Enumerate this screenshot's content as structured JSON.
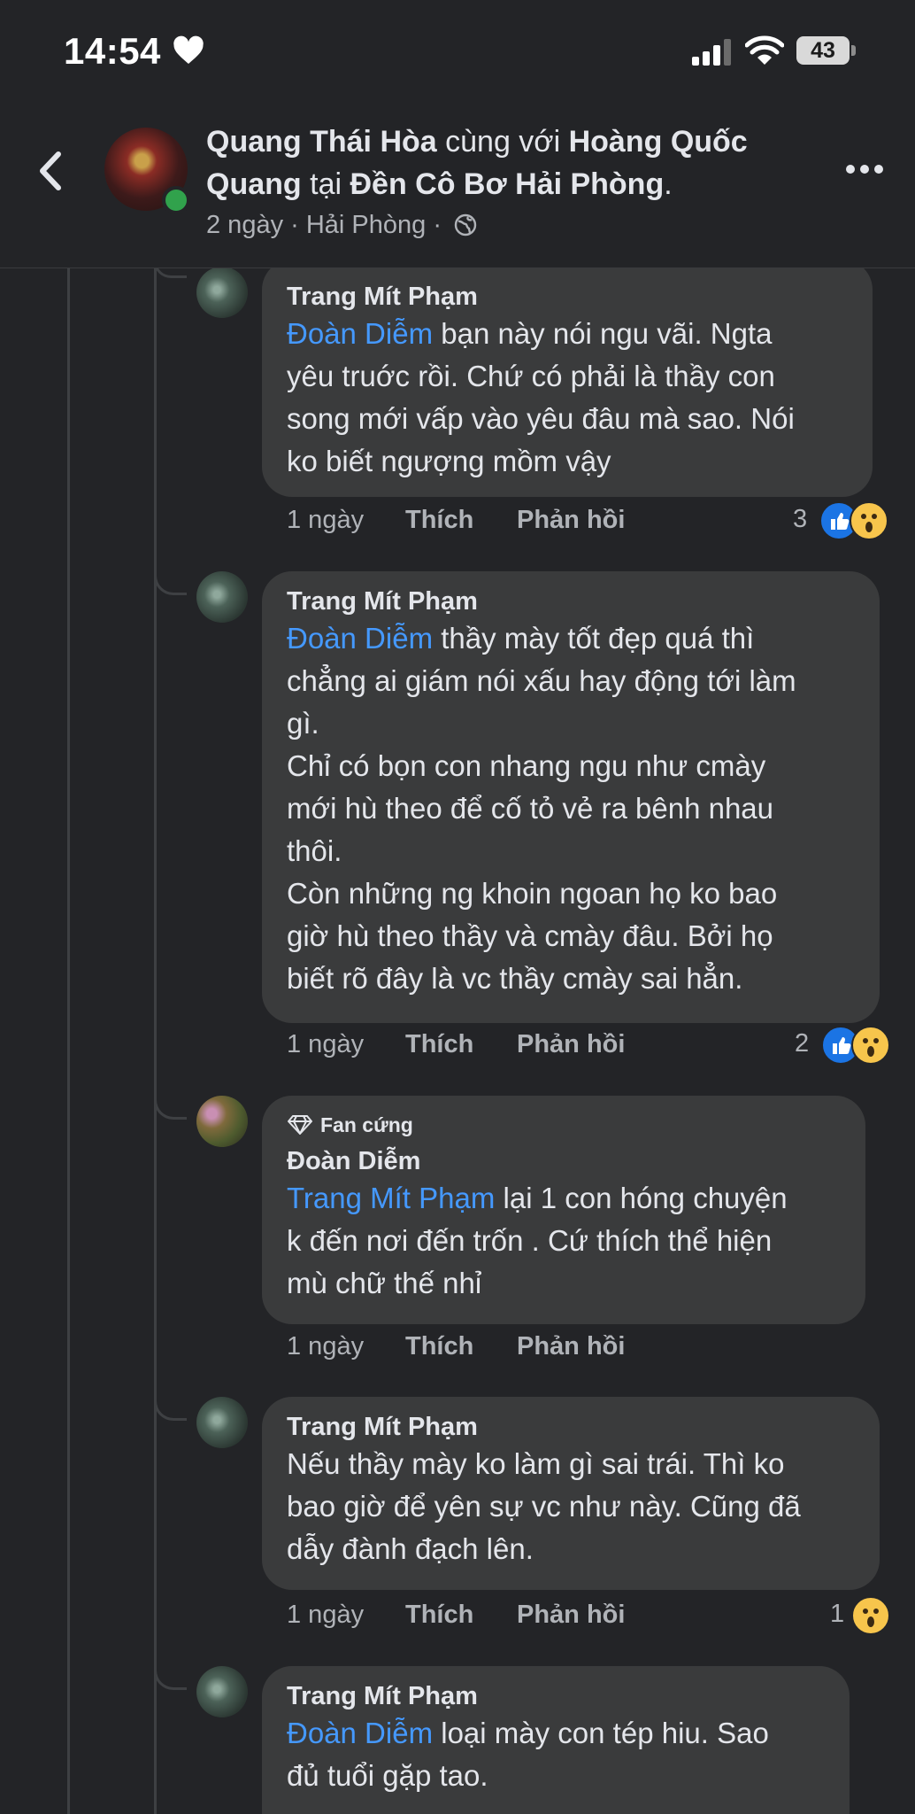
{
  "status_bar": {
    "time": "14:54",
    "battery": "43"
  },
  "header": {
    "author": "Quang Thái Hòa",
    "with_word": " cùng với ",
    "tagged": "Hoàng Quốc Quang",
    "at_word": " tại ",
    "place": "Đền Cô Bơ Hải Phòng",
    "end": ".",
    "meta": "2 ngày · Hải Phòng ·"
  },
  "labels": {
    "like": "Thích",
    "reply": "Phản hồi"
  },
  "comments": [
    {
      "author": "Trang Mít Phạm",
      "mention": "Đoàn Diễm",
      "lines": [
        " bạn này nói ngu vãi. Ngta",
        "yêu truớc rồi. Chứ có phải là thầy con",
        "song mới vấp vào yêu đâu mà sao. Nói",
        "ko biết ngượng mồm vậy"
      ],
      "time": "1 ngày",
      "reaction_count": "3",
      "reactions": [
        "like-icon",
        "wow-icon"
      ]
    },
    {
      "author": "Trang Mít Phạm",
      "mention": "Đoàn Diễm",
      "lines": [
        " thầy mày tốt đẹp quá thì",
        "chẳng ai giám nói xấu hay động tới làm",
        "gì.",
        "Chỉ có bọn con nhang ngu như cmày",
        "mới hù theo để cố tỏ vẻ ra bênh nhau",
        "thôi.",
        "Còn những ng khoin ngoan họ ko bao",
        "giờ hù theo thầy và cmày đâu. Bởi họ",
        "biết rõ đây là vc thầy cmày sai hẳn."
      ],
      "time": "1 ngày",
      "reaction_count": "2",
      "reactions": [
        "like-icon",
        "wow-icon"
      ]
    },
    {
      "badge": "Fan cứng",
      "author": "Đoàn Diễm",
      "mention": "Trang Mít Phạm",
      "lines": [
        " lại 1 con hóng chuyện",
        "k đến nơi đến trốn . Cứ thích thể hiện",
        "mù chữ thế nhỉ"
      ],
      "time": "1 ngày"
    },
    {
      "author": "Trang Mít Phạm",
      "lines": [
        "Nếu thầy mày ko làm gì sai trái. Thì ko",
        "bao giờ để yên sự vc như này. Cũng đã",
        "dẫy đành đạch lên."
      ],
      "time": "1 ngày",
      "reaction_count": "1",
      "reactions": [
        "wow-icon"
      ]
    },
    {
      "author": "Trang Mít Phạm",
      "mention": "Đoàn Diễm",
      "lines": [
        " loại mày con tép hiu. Sao",
        "đủ tuổi gặp tao."
      ]
    }
  ]
}
